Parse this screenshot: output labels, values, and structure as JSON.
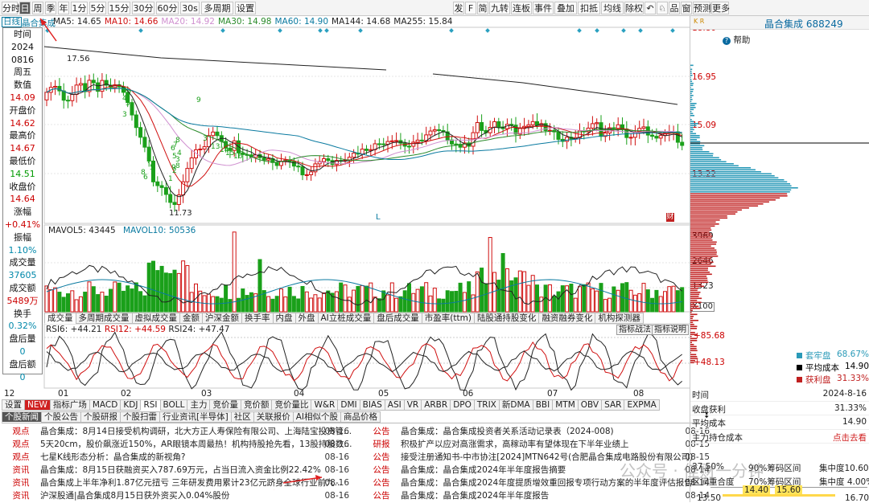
{
  "toolbar": {
    "left": [
      "分时",
      "日",
      "周",
      "季",
      "年",
      "1分",
      "5分",
      "15分",
      "30分",
      "60分",
      "30s",
      "多周期",
      "设置"
    ],
    "right": [
      "发",
      "F",
      "简",
      "九转",
      "连板",
      "事件",
      "叠加",
      "扣抵",
      "均线",
      "除权",
      "↶",
      "♘",
      "品",
      "窗",
      "预测",
      "更多"
    ]
  },
  "ma_line": {
    "period": "日线",
    "stock": "晶合集成",
    "items": [
      {
        "label": "MA5: 14.65",
        "color": "#222222"
      },
      {
        "label": "MA10: 14.66",
        "color": "#d01010"
      },
      {
        "label": "MA20: 14.92",
        "color": "#d090d0"
      },
      {
        "label": "MA30: 14.98",
        "color": "#2a8a2a"
      },
      {
        "label": "MA60: 14.90",
        "color": "#0a7aa0"
      },
      {
        "label": "MA144: 14.68",
        "color": "#222222"
      },
      {
        "label": "MA255: 15.84",
        "color": "#222222"
      }
    ]
  },
  "info_panel": [
    [
      "时间",
      "lb"
    ],
    [
      "2024",
      "lb"
    ],
    [
      "0816",
      "lb"
    ],
    [
      "周五",
      "lb"
    ],
    [
      "数值",
      "lb"
    ],
    [
      "14.09",
      "v"
    ],
    [
      "开盘价",
      "lb"
    ],
    [
      "14.62",
      "v"
    ],
    [
      "最高价",
      "lb"
    ],
    [
      "14.67",
      "v"
    ],
    [
      "最低价",
      "lb"
    ],
    [
      "14.51",
      "g"
    ],
    [
      "收盘价",
      "lb"
    ],
    [
      "14.64",
      "v"
    ],
    [
      "涨幅",
      "lb"
    ],
    [
      "+0.41%",
      "v"
    ],
    [
      "振幅",
      "lb"
    ],
    [
      "1.10%",
      "b"
    ],
    [
      "成交量",
      "lb"
    ],
    [
      "37605",
      "b"
    ],
    [
      "成交额",
      "lb"
    ],
    [
      "5489万",
      "v"
    ],
    [
      "换手",
      "lb"
    ],
    [
      "0.32%",
      "b"
    ],
    [
      "盘后量",
      "lb"
    ],
    [
      "0",
      "b"
    ],
    [
      "盘后额",
      "lb"
    ],
    [
      "0",
      "b"
    ]
  ],
  "price_axis": [
    "18.80",
    "16.95",
    "15.09",
    "13.22"
  ],
  "price_marks": {
    "high": "17.56",
    "low": "11.73",
    "l_marker": "L",
    "fin_marker": "财"
  },
  "td_labels": [
    "9",
    "7",
    "4",
    "5",
    "3",
    "8",
    "6",
    "5",
    "7",
    "8",
    "9",
    "1",
    "2",
    "3",
    "4",
    "5",
    "6",
    "7",
    "8",
    "9",
    "3",
    "13",
    "14",
    "15",
    "16"
  ],
  "vol_line": {
    "mavol5": "MAVOL5: 43445",
    "mavol10": "MAVOL10: 50536"
  },
  "vol_axis": [
    "3969",
    "2646",
    "1323",
    "X100"
  ],
  "vol_tabs": [
    "成交量",
    "多周期成交量",
    "虚拟成交量",
    "金额",
    "沪深金额",
    "换手率",
    "内盘",
    "外盘",
    "AI立桩成交量",
    "盘后成交量",
    "市盈率(ttm)",
    "陆股通持股变化",
    "融资融券变化",
    "机构探测器"
  ],
  "rsi_line": {
    "rsi6": "RSI6: +44.21",
    "rsi12": "RSI12: +44.59",
    "rsi24": "RSI24: +47.47"
  },
  "rsi_axis": [
    "+85.68",
    "+48.13"
  ],
  "rsi_buttons": [
    "指标战法",
    "指标说明"
  ],
  "months": [
    "12",
    "01",
    "02",
    "03",
    "04",
    "05",
    "06",
    "07",
    "08"
  ],
  "ind_tabs": [
    "设置",
    "NEW",
    "指标广场",
    "MACD",
    "KDJ",
    "RSI",
    "BOLL",
    "主力",
    "竞价量",
    "竞价额",
    "竞价量比",
    "W&R",
    "DMI",
    "BIAS",
    "ASI",
    "VR",
    "ARBR",
    "DPO",
    "TRIX",
    "新DMA",
    "BBI",
    "MTM",
    "OBV",
    "SAR",
    "EXPMA"
  ],
  "news_tabs": [
    "个股新闻",
    "个股公告",
    "个股研报",
    "个股扫雷",
    "行业资讯[半导体]",
    "社区",
    "关联报价",
    "AI相似个股",
    "商品价格"
  ],
  "news_left": [
    {
      "cat": "观点",
      "title": "晶合集成：8月14日接受机构调研，北大方正人寿保险有限公司、上海陆宝投资管...",
      "date": "08-16"
    },
    {
      "cat": "观点",
      "title": "5天20cm，股价飙涨近150%，AR眼镜本周最热！机构持股抢先看，13股持股数...",
      "date": "08-16"
    },
    {
      "cat": "观点",
      "title": "七星K线形态分析：晶合集成的新视角?",
      "date": "08-16"
    },
    {
      "cat": "资讯",
      "title": "晶合集成：8月15日获融资买入787.69万元，占当日流入资金比例22.42%",
      "date": "08-16"
    },
    {
      "cat": "资讯",
      "title": "晶合集成上半年净利1.87亿元扭亏 三年研发费用累计23亿元跻身全球行业前九...",
      "date": "08-16"
    },
    {
      "cat": "资讯",
      "title": "沪深股通|晶合集成8月15日获外资买入0.04%股份",
      "date": "08-16"
    }
  ],
  "news_right": [
    {
      "cat": "公告",
      "title": "晶合集成：晶合集成投资者关系活动记录表（2024-008)",
      "date": "08-16"
    },
    {
      "cat": "研报",
      "title": "积极扩产以应对高涨需求，高稼动率有望体现在下半年业绩上",
      "date": "08-15"
    },
    {
      "cat": "公告",
      "title": "接受注册通知书-中市协注[2024]MTN642号(合肥晶合集成电路股份有限公司)",
      "date": "08-15"
    },
    {
      "cat": "公告",
      "title": "晶合集成：晶合集成2024年半年度报告摘要",
      "date": "08-14"
    },
    {
      "cat": "公告",
      "title": "晶合集成：晶合集成2024年度提质增效重回报专项行动方案的半年度评估报告",
      "date": "08-14"
    },
    {
      "cat": "公告",
      "title": "晶合集成：晶合集成2024年半年度报告",
      "date": "08-14"
    }
  ],
  "right_panel": {
    "header": "晶合集成 688249",
    "kr": "K R",
    "help": "帮助",
    "legend": [
      {
        "label": "套牢盘",
        "value": "68.67%",
        "color": "#2a9ab8"
      },
      {
        "label": "平均成本",
        "value": "14.90",
        "color": "#000000"
      },
      {
        "label": "获利盘",
        "value": "31.33%",
        "color": "#c02020"
      }
    ],
    "rows": [
      {
        "label": "时间",
        "value": "2024-8-16",
        "vcolor": "#222222"
      },
      {
        "label": "收盘获利",
        "value": "31.33%",
        "vcolor": "#222222"
      },
      {
        "label": "平均成本",
        "value": "14.90",
        "vcolor": "#222222"
      },
      {
        "label": "主力持仓成本",
        "value": "点击去看",
        "vcolor": "#d02020"
      }
    ],
    "conc90": {
      "pct": "37.50%",
      "label": "90%筹码区间",
      "conc": "集中度10.60%"
    },
    "conc70": {
      "label": "区间重合度",
      "pct": "70%筹码区间",
      "conc": "集中度 4.00%"
    },
    "range_top": [
      "14.40",
      "15.60"
    ],
    "range_bottom": [
      "13.50",
      "16.70"
    ],
    "watermark": "公众号 · 佳财一分钟"
  }
}
